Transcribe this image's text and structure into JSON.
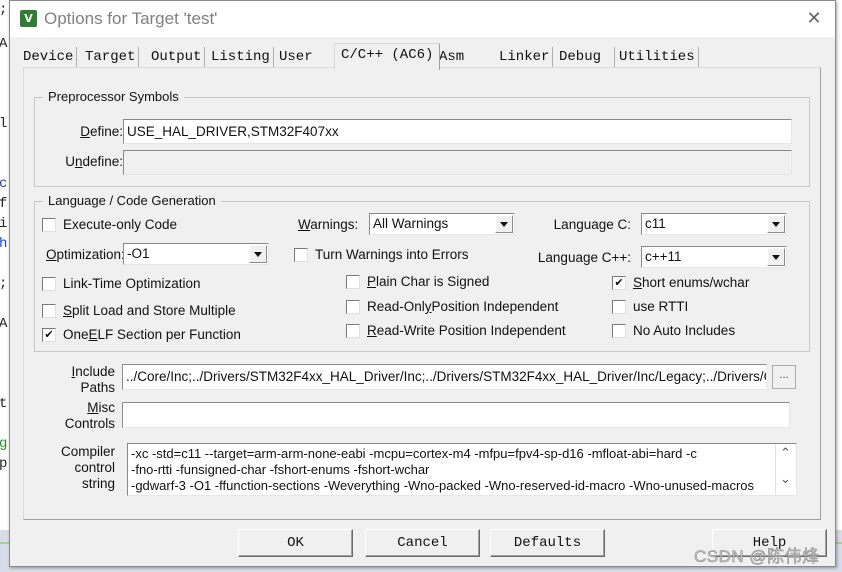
{
  "background": {
    "code_chars": [
      ";",
      "A",
      "l",
      "c",
      "f",
      "i",
      "h",
      ";",
      "A",
      "t",
      "g",
      "p"
    ]
  },
  "window": {
    "title": "Options for Target 'test'",
    "app_icon_glyph": "V",
    "close_glyph": "✕"
  },
  "tabs": [
    {
      "label": "Device",
      "active": false
    },
    {
      "label": "Target",
      "active": false
    },
    {
      "label": "Output",
      "active": false
    },
    {
      "label": "Listing",
      "active": false
    },
    {
      "label": "User",
      "active": false
    },
    {
      "label": "C/C++ (AC6)",
      "active": true
    },
    {
      "label": "Asm",
      "active": false
    },
    {
      "label": "Linker",
      "active": false
    },
    {
      "label": "Debug",
      "active": false
    },
    {
      "label": "Utilities",
      "active": false
    }
  ],
  "preprocessor": {
    "title": "Preprocessor Symbols",
    "define_label_pre": "",
    "define_label_u": "D",
    "define_label_post": "efine:",
    "define_value": "USE_HAL_DRIVER,STM32F407xx",
    "undefine_label_pre": "U",
    "undefine_label_u": "n",
    "undefine_label_post": "define:",
    "undefine_value": ""
  },
  "language": {
    "title": "Language / Code Generation",
    "execute_only": {
      "label": "Execute-only Code",
      "checked": false
    },
    "optimization": {
      "label_u": "O",
      "label_post": "ptimization:",
      "value": "-O1"
    },
    "link_time": {
      "label": "Link-Time Optimization",
      "checked": false
    },
    "split_load": {
      "label_u": "S",
      "label_post": "plit Load and Store Multiple",
      "checked": false
    },
    "one_elf": {
      "label_pre": "One ",
      "label_u": "E",
      "label_post": "LF Section per Function",
      "checked": true
    },
    "warnings": {
      "label_u": "W",
      "label_post": "arnings:",
      "value": "All Warnings"
    },
    "turn_warnings": {
      "label": "Turn Warnings into Errors",
      "checked": false
    },
    "plain_char": {
      "label_u": "P",
      "label_post": "lain Char is Signed",
      "checked": false
    },
    "ro_pi": {
      "label_pre": "Read-Onl",
      "label_u": "y",
      "label_post": " Position Independent",
      "checked": false
    },
    "rw_pi": {
      "label_u": "R",
      "label_post": "ead-Write Position Independent",
      "checked": false
    },
    "language_c": {
      "label": "Language C:",
      "value": "c11"
    },
    "language_cpp": {
      "label": "Language C++:",
      "value": "c++11"
    },
    "short_enums": {
      "label_u": "S",
      "label_post": "hort enums/wchar",
      "checked": true
    },
    "use_rtti": {
      "label": "use RTTI",
      "checked": false
    },
    "no_auto_includes": {
      "label": "No Auto Includes",
      "checked": false
    }
  },
  "include_paths": {
    "label_u": "I",
    "label_post1": "nclude",
    "label_line2": "Paths",
    "value": "../Core/Inc;../Drivers/STM32F4xx_HAL_Driver/Inc;../Drivers/STM32F4xx_HAL_Driver/Inc/Legacy;../Drivers/CMSIS",
    "browse_label": "..."
  },
  "misc_controls": {
    "label_u": "M",
    "label_post1": "isc",
    "label_line2": "Controls",
    "value": ""
  },
  "compiler_string": {
    "label_line1": "Compiler",
    "label_line2": "control",
    "label_line3": "string",
    "lines": [
      "-xc -std=c11 --target=arm-arm-none-eabi -mcpu=cortex-m4 -mfpu=fpv4-sp-d16 -mfloat-abi=hard -c",
      "-fno-rtti -funsigned-char -fshort-enums -fshort-wchar",
      "-gdwarf-3 -O1 -ffunction-sections -Weverything -Wno-packed -Wno-reserved-id-macro -Wno-unused-macros"
    ],
    "scroll_up": "⌃",
    "scroll_down": "⌄"
  },
  "buttons": {
    "ok": "OK",
    "cancel": "Cancel",
    "defaults": "Defaults",
    "help": "Help"
  },
  "watermark": "CSDN @陈伟烽",
  "check_glyph": "✔"
}
